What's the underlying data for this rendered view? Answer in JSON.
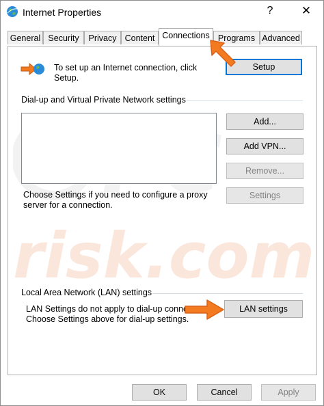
{
  "window": {
    "title": "Internet Properties",
    "help_glyph": "?",
    "close_glyph": "✕"
  },
  "tabs": [
    {
      "label": "General"
    },
    {
      "label": "Security"
    },
    {
      "label": "Privacy"
    },
    {
      "label": "Content"
    },
    {
      "label": "Connections",
      "active": true
    },
    {
      "label": "Programs"
    },
    {
      "label": "Advanced"
    }
  ],
  "setup": {
    "text": "To set up an Internet connection, click Setup.",
    "button": "Setup"
  },
  "dialup": {
    "heading": "Dial-up and Virtual Private Network settings",
    "buttons": {
      "add": "Add...",
      "add_vpn": "Add VPN...",
      "remove": "Remove...",
      "settings": "Settings"
    },
    "proxy_text": "Choose Settings if you need to configure a proxy server for a connection."
  },
  "lan": {
    "heading": "Local Area Network (LAN) settings",
    "line1": "LAN Settings do not apply to dial-up conne",
    "line2": "Choose Settings above for dial-up settings.",
    "button": "LAN settings"
  },
  "footer": {
    "ok": "OK",
    "cancel": "Cancel",
    "apply": "Apply"
  },
  "colors": {
    "accent": "#0078d7",
    "arrow": "#f47a20"
  }
}
